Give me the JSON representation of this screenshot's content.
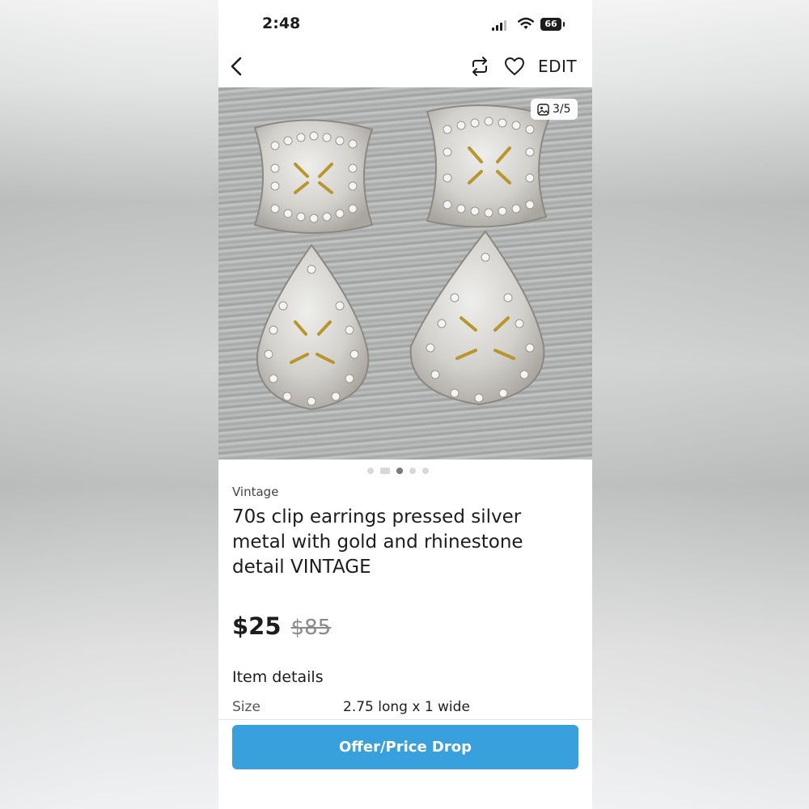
{
  "status_bar": {
    "time": "2:48",
    "battery": "66"
  },
  "nav": {
    "edit_label": "EDIT",
    "icons": [
      "chevron-left-icon",
      "share-icon",
      "heart-icon"
    ]
  },
  "photo": {
    "counter": "3/5",
    "description_icon": "photo-icon"
  },
  "carousel": {
    "total": 5,
    "active_index": 2
  },
  "listing": {
    "brand": "Vintage",
    "title": "70s clip earrings pressed silver metal with gold and rhinestone detail VINTAGE",
    "price": "$25",
    "original_price": "$85"
  },
  "item_details": {
    "heading": "Item details",
    "rows": [
      {
        "key": "Size",
        "value": "2.75 long x 1 wide"
      }
    ]
  },
  "cta": {
    "label": "Offer/Price Drop",
    "color": "#39a0de"
  }
}
